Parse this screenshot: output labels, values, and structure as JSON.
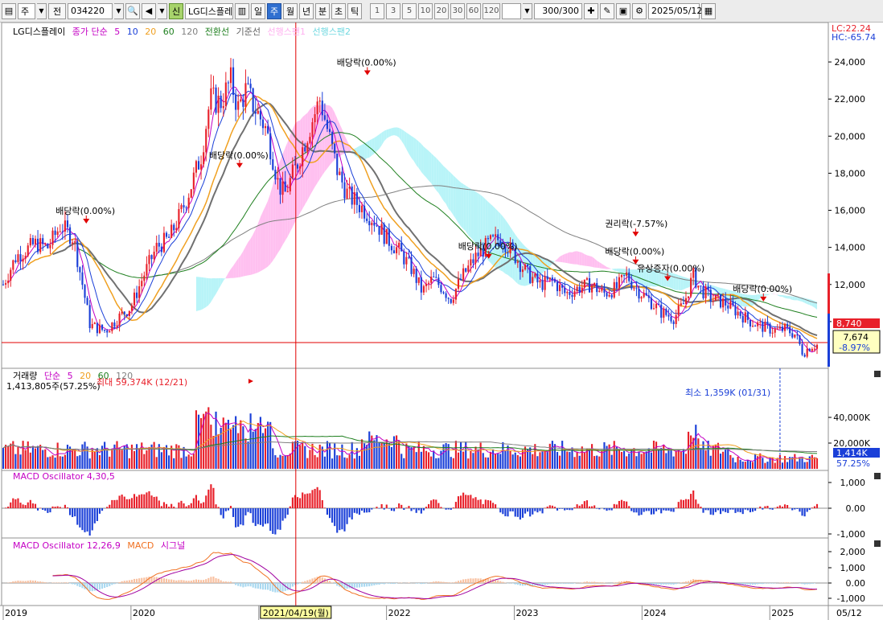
{
  "toolbar": {
    "market": "주",
    "prev": "전",
    "code": "034220",
    "new_badge": "신",
    "stock_name": "LG디스플레",
    "periods": [
      "일",
      "주",
      "월",
      "년",
      "분",
      "초",
      "틱"
    ],
    "active_period": "주",
    "intervals": [
      "1",
      "3",
      "5",
      "10",
      "20",
      "30",
      "60",
      "120"
    ],
    "count": "300",
    "count_total": "/300",
    "date": "2025/05/12"
  },
  "price_pane": {
    "name": "LG디스플레이",
    "ma_label": "종가 단순",
    "ma_periods": [
      "5",
      "10",
      "20",
      "60",
      "120"
    ],
    "ichimoku": [
      "전환선",
      "기준선",
      "선행스팬1",
      "선행스팬2"
    ],
    "lc": "LC:22.24",
    "hc": "HC:-65.74",
    "y_ticks": [
      "24,000",
      "22,000",
      "20,000",
      "18,000",
      "16,000",
      "14,000",
      "12,000",
      "10,000"
    ],
    "current_price_tag": "8,740",
    "info_price": "7,674",
    "info_change": "-8.97%",
    "annotations": [
      {
        "text": "배당락(0.00%)",
        "x": 2019.65,
        "y": 15200
      },
      {
        "text": "배당락(0.00%)",
        "x": 2020.85,
        "y": 18200
      },
      {
        "text": "배당락(0.00%)",
        "x": 2021.85,
        "y": 23200
      },
      {
        "text": "배당락(0.00%)",
        "x": 2022.8,
        "y": 13300
      },
      {
        "text": "권리락(-7.57%)",
        "x": 2023.95,
        "y": 14500
      },
      {
        "text": "배당락(0.00%)",
        "x": 2023.95,
        "y": 13000
      },
      {
        "text": "유상증자(0.00%)",
        "x": 2024.2,
        "y": 12100
      },
      {
        "text": "배당락(0.00%)",
        "x": 2024.95,
        "y": 11000
      }
    ]
  },
  "volume_pane": {
    "label": "거래량",
    "ma_label": "단순",
    "ma_periods": [
      "5",
      "20",
      "60",
      "120"
    ],
    "current": "1,413,805주(57.25%)",
    "max_label": "최대 59,374K (12/21)",
    "min_label": "최소 1,359K (01/31)",
    "y_ticks": [
      "40,000K",
      "20,000K"
    ],
    "tag_value": "1,414K",
    "tag_pct": "57.25%"
  },
  "macd_osc_pane": {
    "label": "MACD Oscillator 4,30,5",
    "y_ticks": [
      "1,000",
      "0.00",
      "-1,000"
    ]
  },
  "macd_pane": {
    "label": "MACD Oscillator 12,26,9",
    "macd": "MACD",
    "signal": "시그널",
    "y_ticks": [
      "2,000",
      "1,000",
      "0.00",
      "-1,000"
    ]
  },
  "x_axis": {
    "labels": [
      "2019",
      "2020",
      "2021",
      "2022",
      "2023",
      "2024",
      "2025",
      "05/12"
    ],
    "cursor_date": "2021/04/19(월)"
  },
  "colors": {
    "up": "#e8202a",
    "down": "#1a3fd8",
    "ma5": "#c400c4",
    "ma10": "#1a3fd8",
    "ma20": "#f0a020",
    "ma60": "#208020",
    "ma120": "#808080",
    "cloud_up": "#ffc0f0",
    "cloud_down": "#b8f4f8",
    "cursor": "#e00000"
  },
  "chart_data": {
    "type": "candlestick",
    "title": "LG디스플레이",
    "x_range": [
      2019.0,
      2025.37
    ],
    "y_range": [
      8000,
      25000
    ],
    "price_path": [
      [
        2019.0,
        12000
      ],
      [
        2019.1,
        13500
      ],
      [
        2019.25,
        14200
      ],
      [
        2019.35,
        14000
      ],
      [
        2019.45,
        15200
      ],
      [
        2019.55,
        14500
      ],
      [
        2019.62,
        12000
      ],
      [
        2019.68,
        9800
      ],
      [
        2019.8,
        9500
      ],
      [
        2019.9,
        10200
      ],
      [
        2020.0,
        10800
      ],
      [
        2020.1,
        12500
      ],
      [
        2020.2,
        14000
      ],
      [
        2020.3,
        14500
      ],
      [
        2020.4,
        16000
      ],
      [
        2020.48,
        17500
      ],
      [
        2020.55,
        19000
      ],
      [
        2020.62,
        22000
      ],
      [
        2020.7,
        21800
      ],
      [
        2020.78,
        23000
      ],
      [
        2020.84,
        21500
      ],
      [
        2020.9,
        22500
      ],
      [
        2020.97,
        21500
      ],
      [
        2021.05,
        20500
      ],
      [
        2021.1,
        19200
      ],
      [
        2021.15,
        17500
      ],
      [
        2021.2,
        16800
      ],
      [
        2021.3,
        18500
      ],
      [
        2021.4,
        20500
      ],
      [
        2021.48,
        22000
      ],
      [
        2021.55,
        20000
      ],
      [
        2021.62,
        18000
      ],
      [
        2021.7,
        16800
      ],
      [
        2021.8,
        16200
      ],
      [
        2021.9,
        15500
      ],
      [
        2022.0,
        14500
      ],
      [
        2022.1,
        13800
      ],
      [
        2022.2,
        12800
      ],
      [
        2022.28,
        11600
      ],
      [
        2022.36,
        12300
      ],
      [
        2022.44,
        11800
      ],
      [
        2022.5,
        11200
      ],
      [
        2022.6,
        12500
      ],
      [
        2022.7,
        13500
      ],
      [
        2022.8,
        14200
      ],
      [
        2022.9,
        14500
      ],
      [
        2023.0,
        13600
      ],
      [
        2023.1,
        12600
      ],
      [
        2023.2,
        12000
      ],
      [
        2023.3,
        12200
      ],
      [
        2023.4,
        11500
      ],
      [
        2023.5,
        11800
      ],
      [
        2023.6,
        12000
      ],
      [
        2023.7,
        11500
      ],
      [
        2023.8,
        11800
      ],
      [
        2023.88,
        12500
      ],
      [
        2023.95,
        11800
      ],
      [
        2024.05,
        11200
      ],
      [
        2024.15,
        10500
      ],
      [
        2024.25,
        10200
      ],
      [
        2024.33,
        11000
      ],
      [
        2024.4,
        12500
      ],
      [
        2024.45,
        11800
      ],
      [
        2024.55,
        11200
      ],
      [
        2024.65,
        11000
      ],
      [
        2024.75,
        10500
      ],
      [
        2024.85,
        10000
      ],
      [
        2024.95,
        9700
      ],
      [
        2025.05,
        9500
      ],
      [
        2025.12,
        9600
      ],
      [
        2025.2,
        9300
      ],
      [
        2025.26,
        8300
      ],
      [
        2025.32,
        8700
      ],
      [
        2025.37,
        8740
      ]
    ],
    "annotations_xy": [
      {
        "label": "최대 59,374K (12/21)",
        "x": 2020.97
      },
      {
        "label": "최소 1,359K (01/31)",
        "x": 2025.08
      }
    ]
  }
}
